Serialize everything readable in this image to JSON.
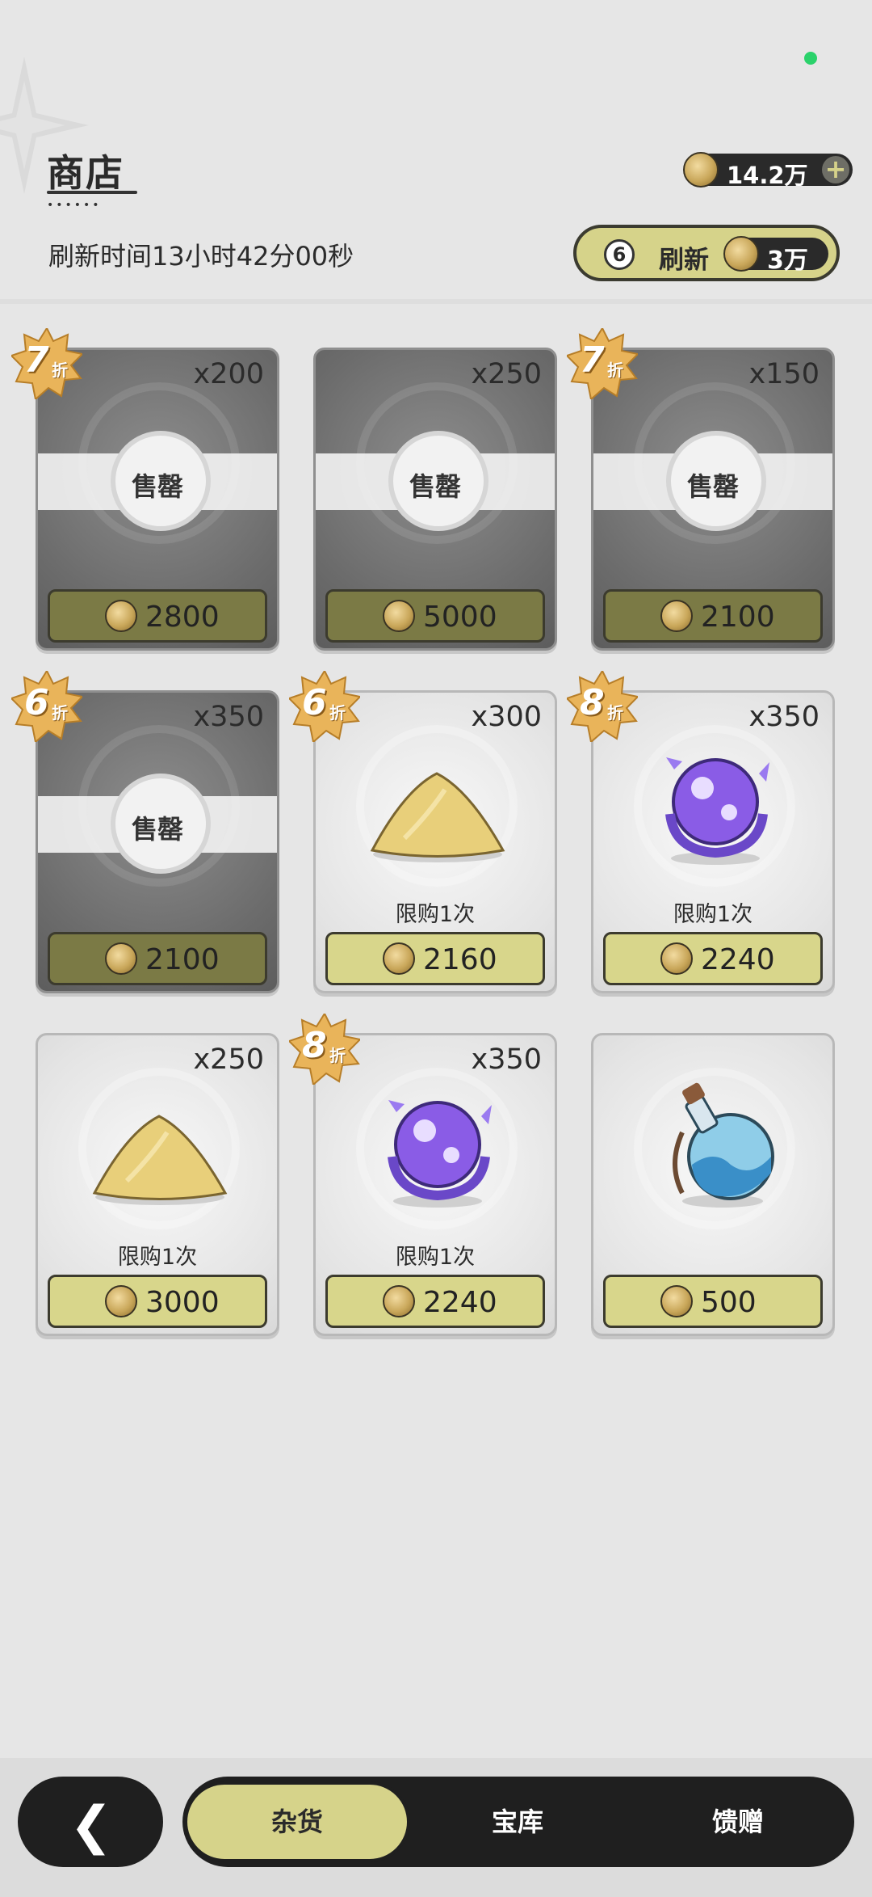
{
  "header": {
    "title": "商店",
    "currency_amount": "14.2万",
    "refresh_timer": "刷新时间13小时42分00秒",
    "refresh_count": "6",
    "refresh_label": "刷新",
    "refresh_cost": "3万"
  },
  "items": [
    {
      "qty": "x200",
      "price": "2800",
      "discount": "7",
      "sold_out": true
    },
    {
      "qty": "x250",
      "price": "5000",
      "discount": "",
      "sold_out": true
    },
    {
      "qty": "x150",
      "price": "2100",
      "discount": "7",
      "sold_out": true
    },
    {
      "qty": "x350",
      "price": "2100",
      "discount": "6",
      "sold_out": true
    },
    {
      "qty": "x300",
      "price": "2160",
      "discount": "6",
      "limit": "限购1次",
      "item": "sand-pile-icon"
    },
    {
      "qty": "x350",
      "price": "2240",
      "discount": "8",
      "limit": "限购1次",
      "item": "purple-orb-icon"
    },
    {
      "qty": "x250",
      "price": "3000",
      "discount": "",
      "limit": "限购1次",
      "item": "sand-pile-icon"
    },
    {
      "qty": "x350",
      "price": "2240",
      "discount": "8",
      "limit": "限购1次",
      "item": "purple-orb-icon"
    },
    {
      "qty": "",
      "price": "500",
      "discount": "",
      "item": "potion-flask-icon"
    }
  ],
  "labels": {
    "sold_out": "售罄",
    "discount_suffix": "折"
  },
  "nav": {
    "back_icon": "chevron-left-icon",
    "tabs": [
      "杂货",
      "宝库",
      "馈赠"
    ],
    "active_tab": "杂货"
  },
  "colors": {
    "accent": "#d6d38a",
    "dark": "#1f1f1f",
    "badge": "#e9b45a"
  }
}
